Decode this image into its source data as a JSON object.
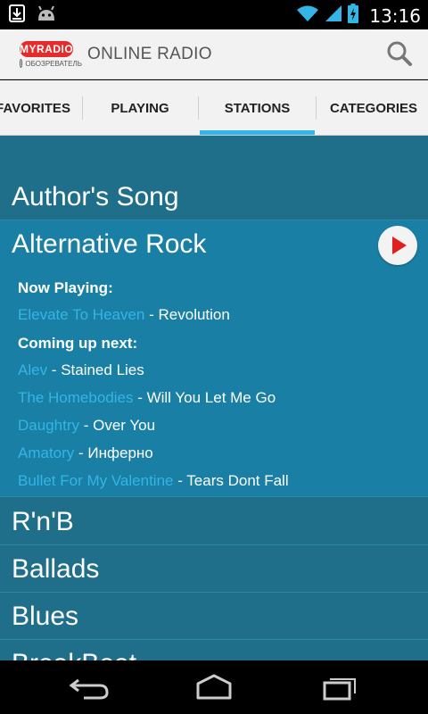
{
  "status_bar": {
    "time": "13:16",
    "icons": [
      "download-icon",
      "android-icon",
      "wifi-icon",
      "signal-icon",
      "battery-charging-icon"
    ]
  },
  "action_bar": {
    "logo_badge": "MYRADIO",
    "logo_sub": "ОБОЗРЕВАТЕЛЬ",
    "title": "ONLINE RADIO",
    "search_icon": "search-icon"
  },
  "tabs": [
    {
      "label": "FAVORITES",
      "active": false
    },
    {
      "label": "PLAYING",
      "active": false
    },
    {
      "label": "STATIONS",
      "active": true
    },
    {
      "label": "CATEGORIES",
      "active": false
    }
  ],
  "genres_top": [
    {
      "label": "Author's Song"
    }
  ],
  "expanded_genre": {
    "label": "Alternative Rock",
    "now_playing_label": "Now Playing:",
    "now_playing": {
      "artist": "Elevate To Heaven",
      "title": "Revolution"
    },
    "coming_up_label": "Coming up next:",
    "coming_up": [
      {
        "artist": "Alev",
        "title": "Stained Lies"
      },
      {
        "artist": "The Homebodies",
        "title": "Will You Let Me Go"
      },
      {
        "artist": "Daughtry",
        "title": "Over You"
      },
      {
        "artist": "Amatory",
        "title": "Инферно"
      },
      {
        "artist": "Bullet For My Valentine",
        "title": "Tears Dont Fall"
      }
    ]
  },
  "genres_bottom": [
    {
      "label": "R'n'B"
    },
    {
      "label": "Ballads"
    },
    {
      "label": "Blues"
    },
    {
      "label": "BreakBeat"
    }
  ],
  "separator": " - ",
  "colors": {
    "accent": "#33b5e5",
    "content_bg": "#1f6f8b",
    "expanded_bg": "#1a7fa5",
    "play_red": "#e02020",
    "logo_red": "#e52b2b"
  },
  "nav_bar": [
    "back-icon",
    "home-icon",
    "recent-apps-icon"
  ]
}
